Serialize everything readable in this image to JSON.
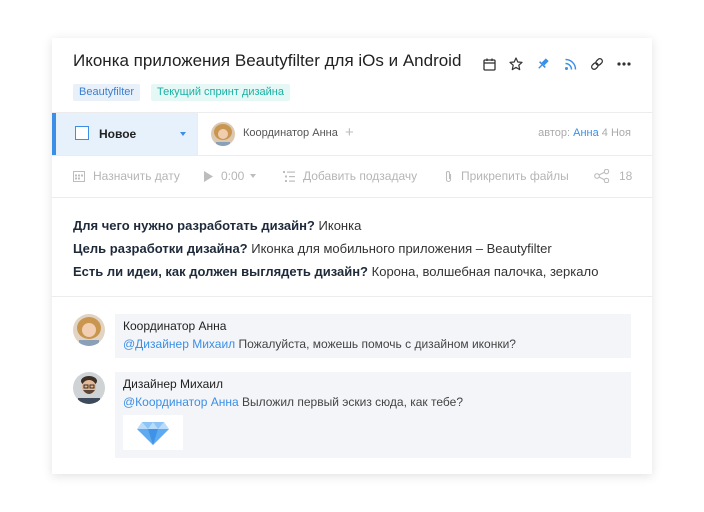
{
  "task": {
    "title": "Иконка приложения Beautyfilter для iOs и Android",
    "tags": [
      "Beautyfilter",
      "Текущий спринт дизайна"
    ]
  },
  "toolbar": {
    "icons": [
      "calendar-icon",
      "star-icon",
      "pin-icon",
      "rss-icon",
      "link-icon",
      "more-icon"
    ]
  },
  "status": {
    "label": "Новое"
  },
  "assignee": {
    "name": "Координатор Анна"
  },
  "meta": {
    "prefix": "автор:",
    "author": "Анна",
    "date": "4 Ноя"
  },
  "actions": {
    "date": "Назначить дату",
    "time": "0:00",
    "subtask": "Добавить подзадачу",
    "attach": "Прикрепить файлы",
    "count": "18"
  },
  "description": [
    {
      "q": "Для чего нужно разработать дизайн?",
      "a": "Иконка"
    },
    {
      "q": "Цель разработки дизайна?",
      "a": "Иконка для мобильного приложения – Beautyfilter"
    },
    {
      "q": "Есть ли идеи, как должен выглядеть дизайн?",
      "a": "Корона, волшебная палочка, зеркало"
    }
  ],
  "comments": [
    {
      "author": "Координатор Анна",
      "mention": "@Дизайнер Михаил",
      "text": "Пожалуйста, можешь помочь с дизайном иконки?"
    },
    {
      "author": "Дизайнер Михаил",
      "mention": "@Координатор Анна",
      "text": "Выложил первый эскиз сюда, как тебе?"
    }
  ],
  "colors": {
    "accent": "#3b8fe6",
    "status_bg": "#e6f1fc",
    "tag_blue_bg": "#e8f0f9",
    "tag_teal_text": "#18b1a4"
  }
}
